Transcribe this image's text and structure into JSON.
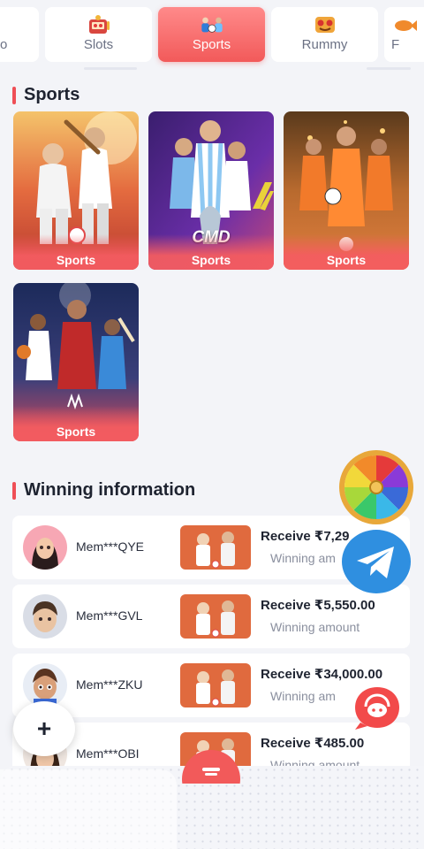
{
  "tabs": [
    {
      "label": "o",
      "icon": "truncated-tab-icon"
    },
    {
      "label": "Slots",
      "icon": "slots-icon"
    },
    {
      "label": "Sports",
      "icon": "sports-icon",
      "active": true
    },
    {
      "label": "Rummy",
      "icon": "rummy-icon"
    },
    {
      "label": "F",
      "icon": "fishing-icon"
    }
  ],
  "sports_section": {
    "title": "Sports",
    "games": [
      {
        "label": "Sports",
        "logo": ""
      },
      {
        "label": "Sports",
        "logo": "CMD"
      },
      {
        "label": "Sports",
        "logo": ""
      },
      {
        "label": "Sports",
        "logo": ""
      }
    ]
  },
  "winning_section": {
    "title": "Winning information",
    "rows": [
      {
        "user": "Mem***QYE",
        "receive": "Receive ₹7,29",
        "amount_label": "Winning am"
      },
      {
        "user": "Mem***GVL",
        "receive": "Receive ₹5,550.00",
        "amount_label": "Winning amount"
      },
      {
        "user": "Mem***ZKU",
        "receive": "Receive ₹34,000.00",
        "amount_label": "Winning am"
      },
      {
        "user": "Mem***OBI",
        "receive": "Receive ₹485.00",
        "amount_label": "Winning amount"
      }
    ]
  },
  "floating": {
    "plus_label": "+",
    "wheel_icon": "lucky-wheel-icon",
    "telegram_icon": "telegram-icon",
    "support_icon": "customer-service-icon"
  },
  "colors": {
    "accent": "#ef4f56",
    "active_tab": "#f25a5a",
    "background": "#f3f4f8",
    "telegram": "#2f8fe0"
  }
}
